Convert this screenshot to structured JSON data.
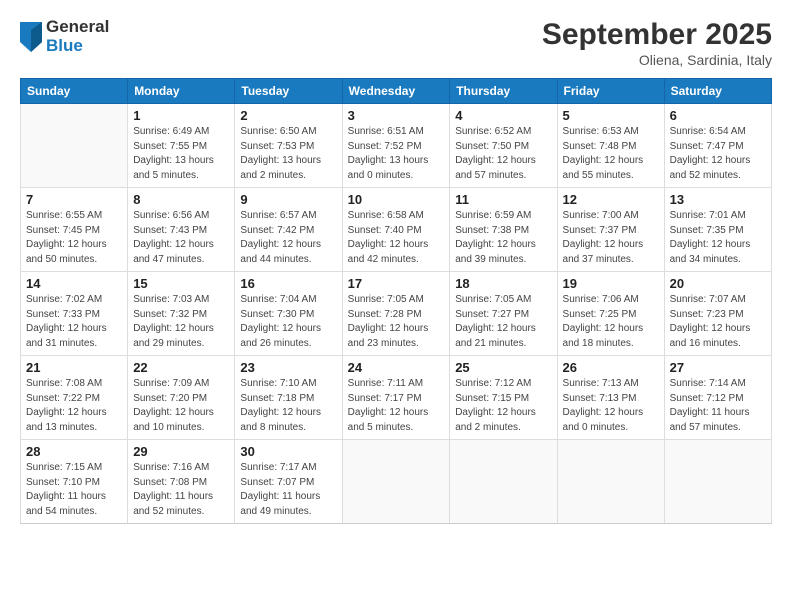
{
  "logo": {
    "general": "General",
    "blue": "Blue"
  },
  "title": "September 2025",
  "location": "Oliena, Sardinia, Italy",
  "days_header": [
    "Sunday",
    "Monday",
    "Tuesday",
    "Wednesday",
    "Thursday",
    "Friday",
    "Saturday"
  ],
  "weeks": [
    [
      {
        "day": "",
        "info": ""
      },
      {
        "day": "1",
        "info": "Sunrise: 6:49 AM\nSunset: 7:55 PM\nDaylight: 13 hours\nand 5 minutes."
      },
      {
        "day": "2",
        "info": "Sunrise: 6:50 AM\nSunset: 7:53 PM\nDaylight: 13 hours\nand 2 minutes."
      },
      {
        "day": "3",
        "info": "Sunrise: 6:51 AM\nSunset: 7:52 PM\nDaylight: 13 hours\nand 0 minutes."
      },
      {
        "day": "4",
        "info": "Sunrise: 6:52 AM\nSunset: 7:50 PM\nDaylight: 12 hours\nand 57 minutes."
      },
      {
        "day": "5",
        "info": "Sunrise: 6:53 AM\nSunset: 7:48 PM\nDaylight: 12 hours\nand 55 minutes."
      },
      {
        "day": "6",
        "info": "Sunrise: 6:54 AM\nSunset: 7:47 PM\nDaylight: 12 hours\nand 52 minutes."
      }
    ],
    [
      {
        "day": "7",
        "info": "Sunrise: 6:55 AM\nSunset: 7:45 PM\nDaylight: 12 hours\nand 50 minutes."
      },
      {
        "day": "8",
        "info": "Sunrise: 6:56 AM\nSunset: 7:43 PM\nDaylight: 12 hours\nand 47 minutes."
      },
      {
        "day": "9",
        "info": "Sunrise: 6:57 AM\nSunset: 7:42 PM\nDaylight: 12 hours\nand 44 minutes."
      },
      {
        "day": "10",
        "info": "Sunrise: 6:58 AM\nSunset: 7:40 PM\nDaylight: 12 hours\nand 42 minutes."
      },
      {
        "day": "11",
        "info": "Sunrise: 6:59 AM\nSunset: 7:38 PM\nDaylight: 12 hours\nand 39 minutes."
      },
      {
        "day": "12",
        "info": "Sunrise: 7:00 AM\nSunset: 7:37 PM\nDaylight: 12 hours\nand 37 minutes."
      },
      {
        "day": "13",
        "info": "Sunrise: 7:01 AM\nSunset: 7:35 PM\nDaylight: 12 hours\nand 34 minutes."
      }
    ],
    [
      {
        "day": "14",
        "info": "Sunrise: 7:02 AM\nSunset: 7:33 PM\nDaylight: 12 hours\nand 31 minutes."
      },
      {
        "day": "15",
        "info": "Sunrise: 7:03 AM\nSunset: 7:32 PM\nDaylight: 12 hours\nand 29 minutes."
      },
      {
        "day": "16",
        "info": "Sunrise: 7:04 AM\nSunset: 7:30 PM\nDaylight: 12 hours\nand 26 minutes."
      },
      {
        "day": "17",
        "info": "Sunrise: 7:05 AM\nSunset: 7:28 PM\nDaylight: 12 hours\nand 23 minutes."
      },
      {
        "day": "18",
        "info": "Sunrise: 7:05 AM\nSunset: 7:27 PM\nDaylight: 12 hours\nand 21 minutes."
      },
      {
        "day": "19",
        "info": "Sunrise: 7:06 AM\nSunset: 7:25 PM\nDaylight: 12 hours\nand 18 minutes."
      },
      {
        "day": "20",
        "info": "Sunrise: 7:07 AM\nSunset: 7:23 PM\nDaylight: 12 hours\nand 16 minutes."
      }
    ],
    [
      {
        "day": "21",
        "info": "Sunrise: 7:08 AM\nSunset: 7:22 PM\nDaylight: 12 hours\nand 13 minutes."
      },
      {
        "day": "22",
        "info": "Sunrise: 7:09 AM\nSunset: 7:20 PM\nDaylight: 12 hours\nand 10 minutes."
      },
      {
        "day": "23",
        "info": "Sunrise: 7:10 AM\nSunset: 7:18 PM\nDaylight: 12 hours\nand 8 minutes."
      },
      {
        "day": "24",
        "info": "Sunrise: 7:11 AM\nSunset: 7:17 PM\nDaylight: 12 hours\nand 5 minutes."
      },
      {
        "day": "25",
        "info": "Sunrise: 7:12 AM\nSunset: 7:15 PM\nDaylight: 12 hours\nand 2 minutes."
      },
      {
        "day": "26",
        "info": "Sunrise: 7:13 AM\nSunset: 7:13 PM\nDaylight: 12 hours\nand 0 minutes."
      },
      {
        "day": "27",
        "info": "Sunrise: 7:14 AM\nSunset: 7:12 PM\nDaylight: 11 hours\nand 57 minutes."
      }
    ],
    [
      {
        "day": "28",
        "info": "Sunrise: 7:15 AM\nSunset: 7:10 PM\nDaylight: 11 hours\nand 54 minutes."
      },
      {
        "day": "29",
        "info": "Sunrise: 7:16 AM\nSunset: 7:08 PM\nDaylight: 11 hours\nand 52 minutes."
      },
      {
        "day": "30",
        "info": "Sunrise: 7:17 AM\nSunset: 7:07 PM\nDaylight: 11 hours\nand 49 minutes."
      },
      {
        "day": "",
        "info": ""
      },
      {
        "day": "",
        "info": ""
      },
      {
        "day": "",
        "info": ""
      },
      {
        "day": "",
        "info": ""
      }
    ]
  ]
}
